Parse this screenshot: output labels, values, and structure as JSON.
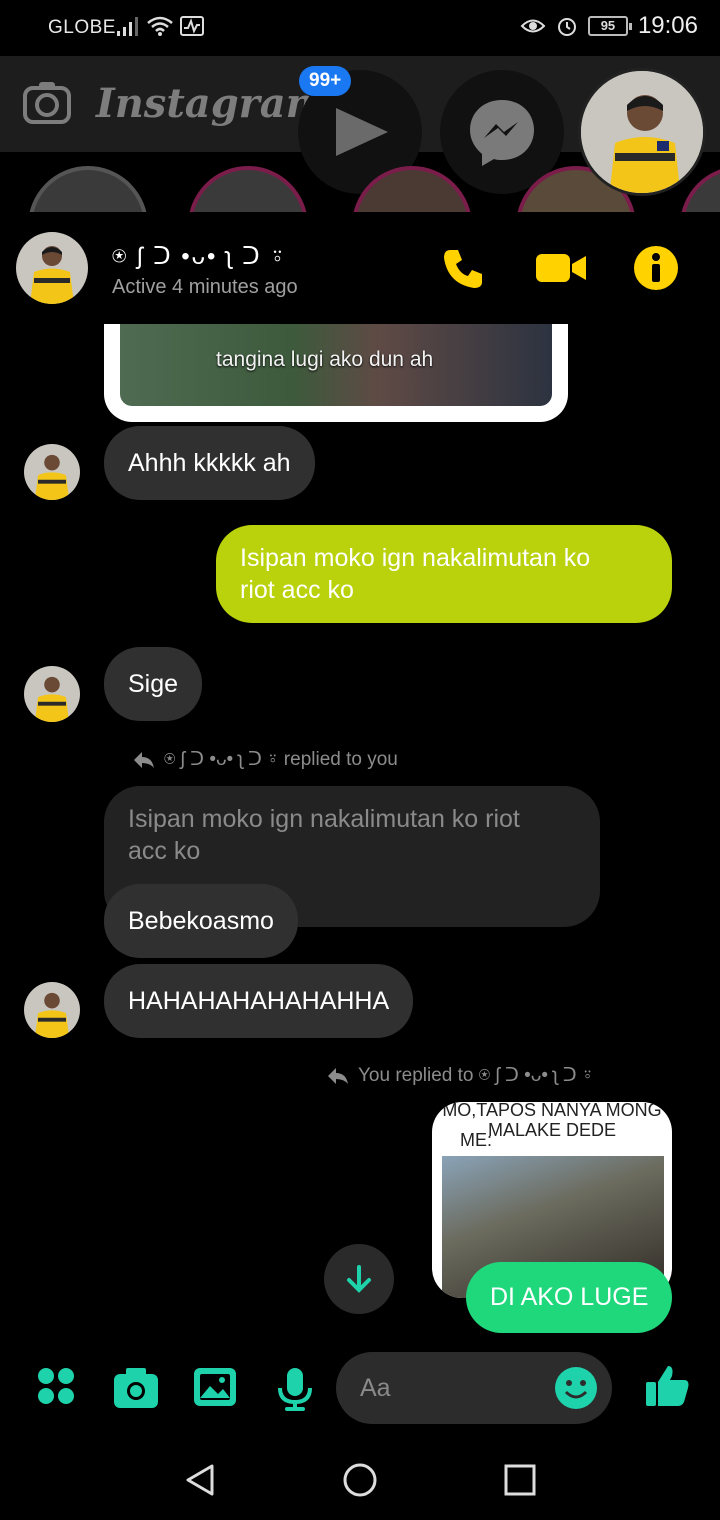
{
  "status_bar": {
    "carrier": "GLOBE",
    "battery": "95",
    "time": "19:06"
  },
  "instagram": {
    "logo": "Instagram",
    "notification_badge": "99+"
  },
  "chat_header": {
    "contact_name": "⍟ ʃ ᑐ •ᴗ• ʅ ᑐ ⍤",
    "status": "Active 4 minutes ago"
  },
  "messages": {
    "media_caption": "tangina lugi ako dun ah",
    "msg1": "Ahhh kkkkk ah",
    "msg2_line1": "Isipan moko ign nakalimutan ko",
    "msg2_line2": "riot acc ko",
    "msg3": "Sige",
    "reply_label_in": "⍟ ʃ ᑐ •ᴗ• ʅ ᑐ ⍤ replied to you",
    "quoted_line1": "Isipan moko ign nakalimutan ko riot",
    "quoted_line2": "acc ko",
    "msg4": "Bebekoasmo",
    "msg5": "HAHAHAHAHAHAHHA",
    "reply_label_out": "You replied to ⍟ ʃ ᑐ •ᴗ• ʅ ᑐ ⍤",
    "meme_top_line": "MO,TAPOS NANYA MONG",
    "meme_second_line": "MALAKE DEDE",
    "meme_me": "ME:",
    "msg6": "DI AKO LUGE"
  },
  "composer": {
    "placeholder": "Aa"
  },
  "colors": {
    "accent": "#1ed3ab",
    "yellow": "#ffd200",
    "outgoing_bubble": "#b9d20b",
    "incoming_bubble": "#303030",
    "green_bubble": "#1fd87c"
  }
}
